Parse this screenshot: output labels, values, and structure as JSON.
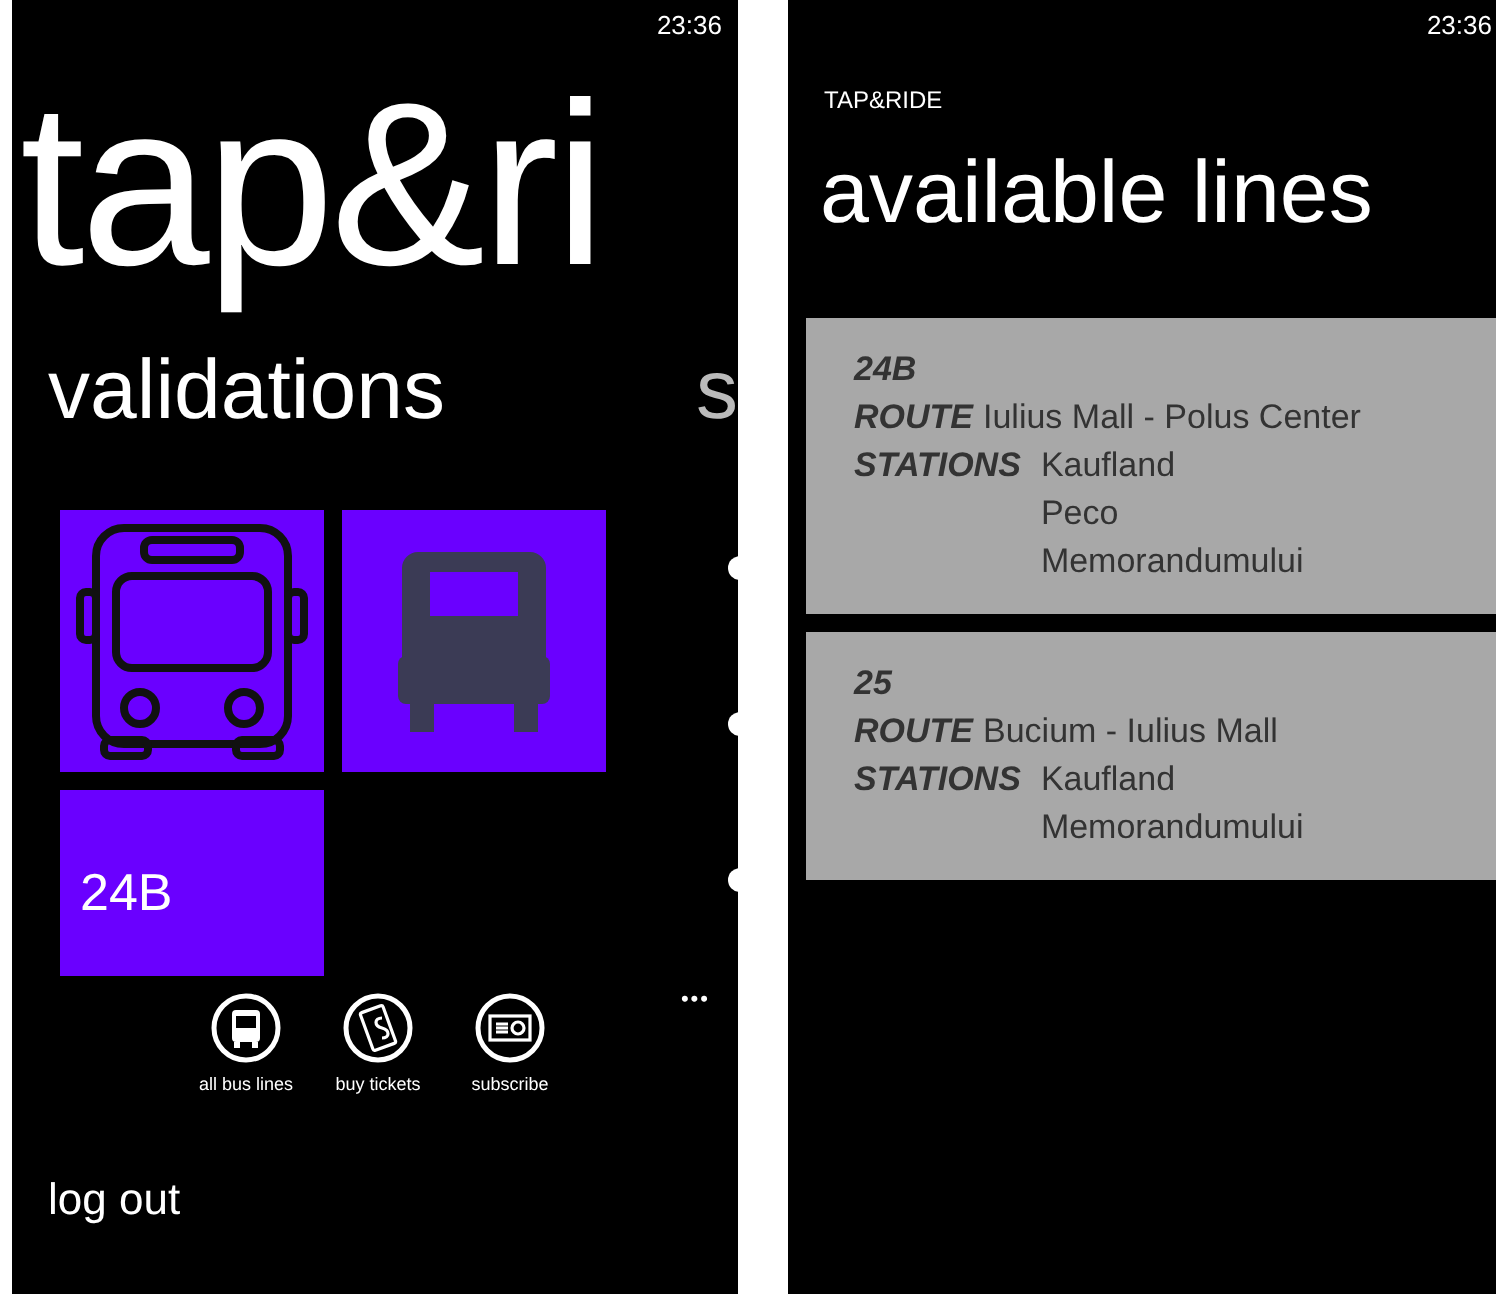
{
  "left_screen": {
    "time": "23:36",
    "app_title": "tap&ri",
    "pivot_items": [
      {
        "label": "validations",
        "selected": true
      },
      {
        "label": "s",
        "selected": false
      }
    ],
    "tiles": [
      {
        "kind": "bus-outline"
      },
      {
        "kind": "bus-solid"
      },
      {
        "kind": "text",
        "label": "24B"
      }
    ],
    "more": "•••",
    "app_bar": [
      {
        "kind": "bus",
        "label": "all bus lines"
      },
      {
        "kind": "ticket",
        "label": "buy tickets"
      },
      {
        "kind": "subscribe",
        "label": "subscribe"
      }
    ],
    "menu_item": "log out"
  },
  "right_screen": {
    "time": "23:36",
    "app_name": "TAP&RIDE",
    "page_title": "available lines",
    "lines": [
      {
        "number": "24B",
        "route_label": "ROUTE",
        "route": "Iulius Mall - Polus Center",
        "stations_label": "STATIONS",
        "stations": [
          "Kaufland",
          "Peco",
          "Memorandumului"
        ]
      },
      {
        "number": "25",
        "route_label": "ROUTE",
        "route": "Bucium - Iulius Mall",
        "stations_label": "STATIONS",
        "stations": [
          "Kaufland",
          "Memorandumului"
        ]
      }
    ]
  }
}
